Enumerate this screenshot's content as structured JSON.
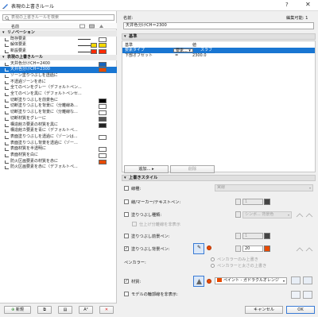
{
  "window": {
    "title": "表現の上書きルール",
    "help": "?",
    "close": "✕"
  },
  "left": {
    "search_placeholder": "表現の上書きルールを検索",
    "col_name": "名前",
    "rows": [
      {
        "kind": "group",
        "label": "リノベーション"
      },
      {
        "kind": "item",
        "label": "既存要素",
        "color": "#ffffff",
        "line": true
      },
      {
        "kind": "item",
        "label": "解体要素",
        "color": "#f5d800",
        "color2": "#f5d800",
        "line": true
      },
      {
        "kind": "item",
        "label": "新設要素",
        "color": "#ff2a00",
        "color2": "#ff2a00",
        "line": true
      },
      {
        "kind": "group",
        "label": "表現の上書きルール"
      },
      {
        "kind": "item",
        "label": "天井色分けCH＝2400",
        "color": "#1565c0"
      },
      {
        "kind": "item",
        "label": "天井色分けCH＝2300",
        "color": "#e84a00",
        "selected": true
      },
      {
        "kind": "item",
        "label": "ゾーン塗りつぶしを透過に"
      },
      {
        "kind": "item",
        "label": "不透過ゾーンを赤に"
      },
      {
        "kind": "item",
        "label": "全てのペンをグレー（デフォルトペン..."
      },
      {
        "kind": "item",
        "label": "全てのペンを黒に（デフォルトペンセ..."
      },
      {
        "kind": "item",
        "label": "切断塗りつぶしを前景色に",
        "color": "#000000"
      },
      {
        "kind": "item",
        "label": "切断塗りつぶしを背景に（分離線あ...",
        "color": "#ffffff"
      },
      {
        "kind": "item",
        "label": "切断塗りつぶしを背景に（分離線な...",
        "color": "#ffffff"
      },
      {
        "kind": "item",
        "label": "切断材質をグレーに",
        "color": "#555555"
      },
      {
        "kind": "item",
        "label": "構造館カ要素の材質を黒に",
        "color": "#222222"
      },
      {
        "kind": "item",
        "label": "構造館カ要素を青に（デフォルトペ..."
      },
      {
        "kind": "item",
        "label": "表面塗りつぶしを透過に（ゾーンは...",
        "color": "#ffffff"
      },
      {
        "kind": "item",
        "label": "表面塗りつぶし背景を透過に（ゾー..."
      },
      {
        "kind": "item",
        "label": "表面材質を半透明に",
        "color": "#ffffff"
      },
      {
        "kind": "item",
        "label": "表面材質を白に",
        "color": "#ffffff"
      },
      {
        "kind": "item",
        "label": "防火区画要素の材質を赤に",
        "color": "#e84a00"
      },
      {
        "kind": "item",
        "label": "防火区画要素を赤に（デフォルトペ..."
      }
    ],
    "btn_new": "新規"
  },
  "right": {
    "name_label": "名前:",
    "edit_date": "編集可能: 1",
    "name_value": "天井色分けCH＝2300",
    "basic_section": "基準",
    "col_criteria": "基準",
    "col_value": "値",
    "criteria_rows": [
      {
        "name": "要素タイプ",
        "op": "要素... ▾",
        "value": "スラブ",
        "selected": true
      },
      {
        "name": "下部オフセット",
        "op": "=",
        "value": "2300.0"
      }
    ],
    "add_btn": "追加...",
    "delete_btn": "削除",
    "style_section": "上書きスタイル",
    "line_type": "線種:",
    "line_type_value": "実線",
    "line_marker_pen": "線/マーカー/テキストペン:",
    "fill_type": "塗りつぶし種類:",
    "fill_type_value": "シンボ... 背景色",
    "fill_transparent": "仕上げ分離線を非表示",
    "fill_fg_pen": "塗りつぶし前景ペン:",
    "fill_bg_pen": "塗りつぶし背景ペン:",
    "pen_color_label": "ペンカラー:",
    "pen_opt1": "ペンカラーのみ上書き",
    "pen_opt2": "ペンカラーと太さの上書き",
    "material": "材質:",
    "material_value": "ペイント - ガドラクルオレンジ",
    "model_outline": "モデルの輪郭線を非表示:",
    "pen1_value": "1",
    "pen_bg_value": "20",
    "cancel": "キャンセル",
    "ok": "OK"
  }
}
